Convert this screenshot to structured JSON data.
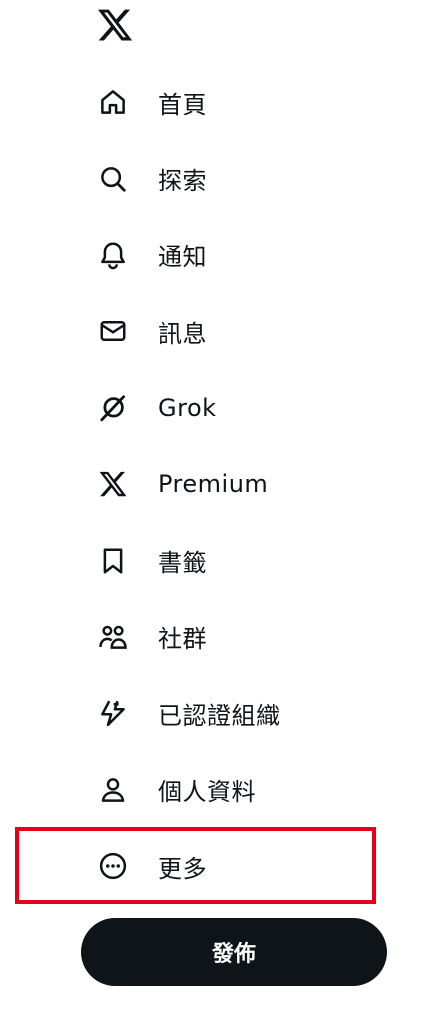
{
  "nav": {
    "items": [
      {
        "label": "首頁",
        "icon": "home-icon"
      },
      {
        "label": "探索",
        "icon": "search-icon"
      },
      {
        "label": "通知",
        "icon": "bell-icon"
      },
      {
        "label": "訊息",
        "icon": "mail-icon"
      },
      {
        "label": "Grok",
        "icon": "grok-icon"
      },
      {
        "label": "Premium",
        "icon": "x-premium-icon"
      },
      {
        "label": "書籤",
        "icon": "bookmark-icon"
      },
      {
        "label": "社群",
        "icon": "communities-icon"
      },
      {
        "label": "已認證組織",
        "icon": "verified-orgs-icon"
      },
      {
        "label": "個人資料",
        "icon": "profile-icon"
      },
      {
        "label": "更多",
        "icon": "more-circle-icon"
      }
    ]
  },
  "post_button": {
    "label": "發佈"
  },
  "colors": {
    "text": "#0f1419",
    "button_bg": "#0f1419",
    "highlight": "#e3001b"
  }
}
